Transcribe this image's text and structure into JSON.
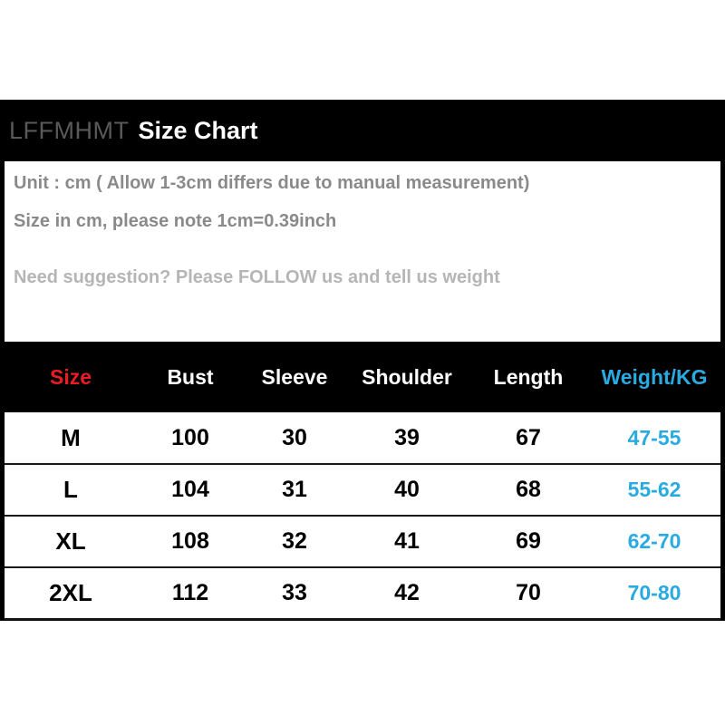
{
  "header": {
    "brand": "LFFMHMT",
    "title": "Size Chart"
  },
  "info": {
    "line1": "Unit : cm ( Allow 1-3cm differs due to manual measurement)",
    "line2": "Size in cm, please note 1cm=0.39inch",
    "line3": "Need suggestion? Please FOLLOW us and tell us weight"
  },
  "colors": {
    "background": "#000000",
    "panel": "#ffffff",
    "size_header": "#ed1c24",
    "weight_header": "#29abe2",
    "weight_value": "#29abe2",
    "info_text": "#8a8a8a",
    "info_text_faded": "#b5b5b5",
    "brand_text": "#595959"
  },
  "chart_data": {
    "type": "table",
    "title": "Size Chart",
    "columns": [
      "Size",
      "Bust",
      "Sleeve",
      "Shoulder",
      "Length",
      "Weight/KG"
    ],
    "rows": [
      {
        "size": "M",
        "bust": "100",
        "sleeve": "30",
        "shoulder": "39",
        "length": "67",
        "weight": "47-55"
      },
      {
        "size": "L",
        "bust": "104",
        "sleeve": "31",
        "shoulder": "40",
        "length": "68",
        "weight": "55-62"
      },
      {
        "size": "XL",
        "bust": "108",
        "sleeve": "32",
        "shoulder": "41",
        "length": "69",
        "weight": "62-70"
      },
      {
        "size": "2XL",
        "bust": "112",
        "sleeve": "33",
        "shoulder": "42",
        "length": "70",
        "weight": "70-80"
      }
    ]
  }
}
